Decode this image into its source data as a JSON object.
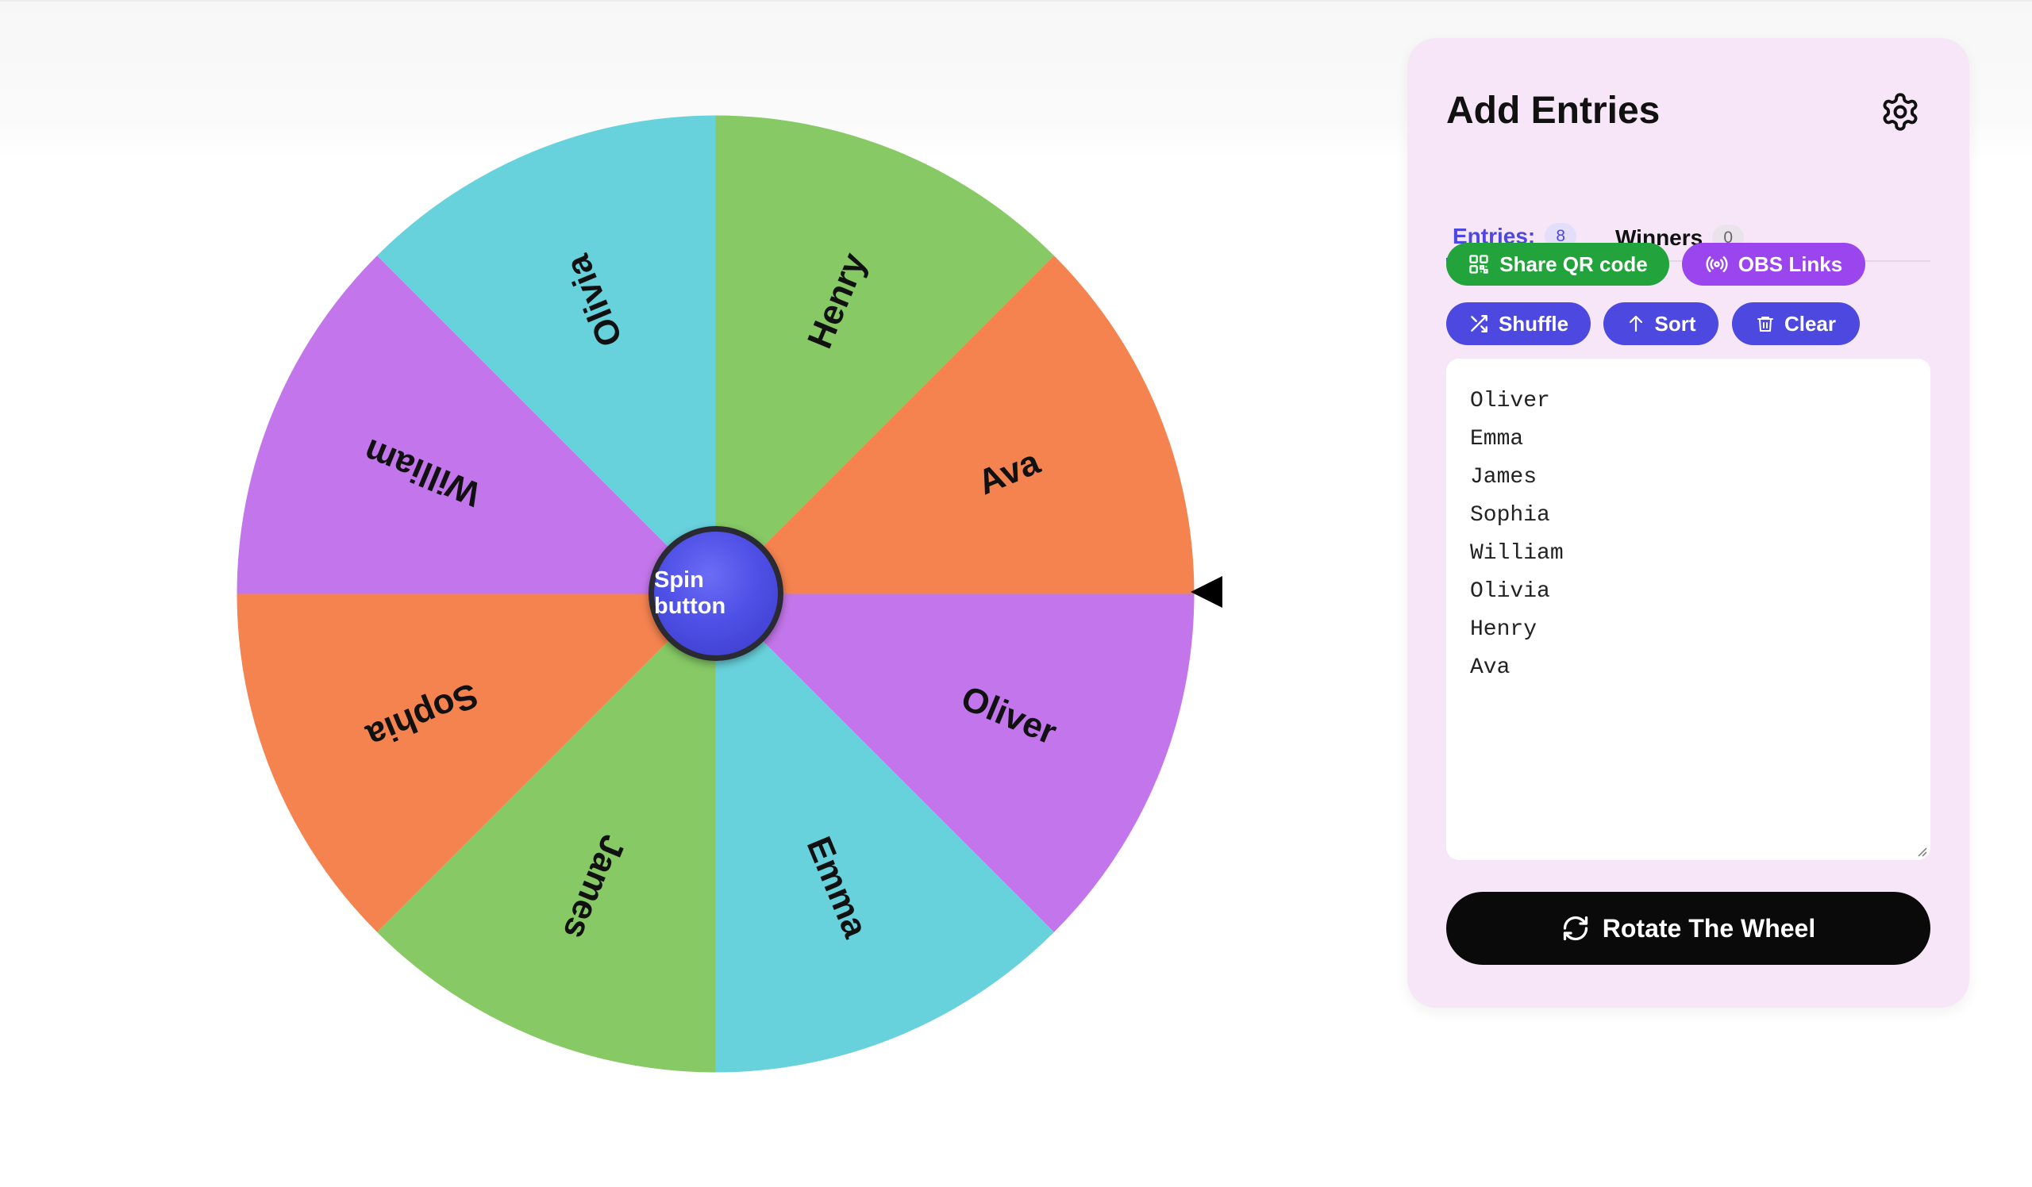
{
  "wheel": {
    "spin_label": "Spin button",
    "segments": [
      {
        "label": "Oliver",
        "color": "#c376eb"
      },
      {
        "label": "Emma",
        "color": "#68d2dc"
      },
      {
        "label": "James",
        "color": "#87c965"
      },
      {
        "label": "Sophia",
        "color": "#f48350"
      },
      {
        "label": "William",
        "color": "#c376eb"
      },
      {
        "label": "Olivia",
        "color": "#68d2dc"
      },
      {
        "label": "Henry",
        "color": "#87c965"
      },
      {
        "label": "Ava",
        "color": "#f48350"
      }
    ]
  },
  "panel": {
    "title": "Add Entries",
    "tabs": {
      "entries": {
        "label": "Entries:",
        "count": "8"
      },
      "winners": {
        "label": "Winners",
        "count": "0"
      }
    },
    "buttons": {
      "share_qr": "Share QR code",
      "obs_links": "OBS Links",
      "shuffle": "Shuffle",
      "sort": "Sort",
      "clear": "Clear"
    },
    "entries": [
      "Oliver",
      "Emma",
      "James",
      "Sophia",
      "William",
      "Olivia",
      "Henry",
      "Ava"
    ],
    "rotate_label": "Rotate The Wheel"
  },
  "colors": {
    "accent": "#4d49e0",
    "panel_bg": "#f6e6f7",
    "qr_green": "#23a33b",
    "obs_purple": "#9b45ee"
  }
}
